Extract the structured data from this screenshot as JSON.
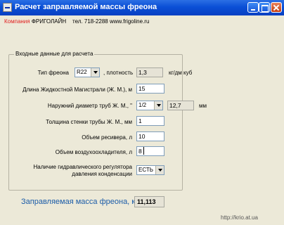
{
  "window": {
    "title": "Расчет заправляемой массы фреона",
    "minimize_label": "",
    "maximize_label": "",
    "close_label": ""
  },
  "company": {
    "label": "Компания",
    "name": "ФРИГОЛАЙН",
    "phone": "тел. 718-2288",
    "website": "www.frigoline.ru"
  },
  "input_group": {
    "title": "Входные данные для расчета",
    "freon_type": {
      "label": "Тип фреона",
      "value": "R22",
      "density_label": ", плотность",
      "density_value": "1,3",
      "density_unit": "кг/дм куб"
    },
    "liquid_line_length": {
      "label": "Длина Жидкостной Магистрали (Ж. М.), м",
      "value": "15"
    },
    "outer_diameter": {
      "label": "Наружний диаметр труб Ж. М., \"",
      "value": "1/2",
      "mm_value": "12,7",
      "mm_unit": "мм"
    },
    "wall_thickness": {
      "label": "Толщина стенки трубы Ж. М., мм",
      "value": "1"
    },
    "receiver_volume": {
      "label": "Объем ресивера, л",
      "value": "10"
    },
    "air_cooler_volume": {
      "label": "Объем воздухоохладителя, л",
      "value": "8"
    },
    "hydraulic_regulator": {
      "label_line1": "Наличие гидравлического регулятора",
      "label_line2": "давления конденсации",
      "value": "ЕСТЬ"
    }
  },
  "result": {
    "label": "Заправляемая масса фреона, кг",
    "value": "11,113"
  },
  "watermark": "http://krio.at.ua"
}
